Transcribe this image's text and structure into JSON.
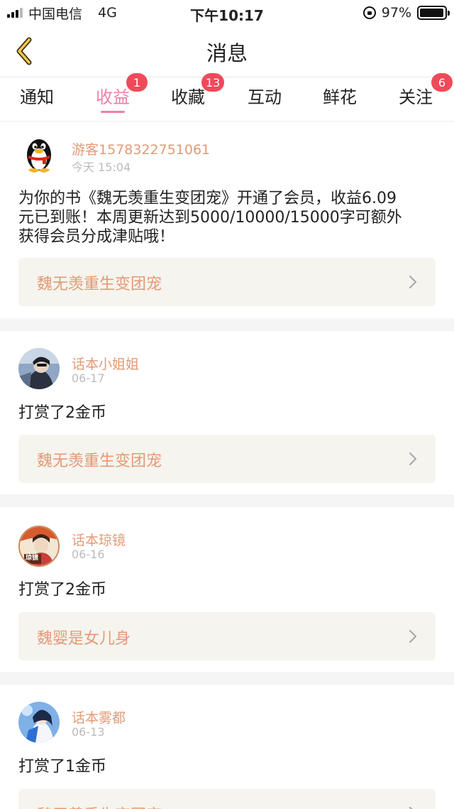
{
  "status_bar": {
    "carrier": "中国电信",
    "network": "4G",
    "time": "下午10:17",
    "battery": "97%",
    "battery_level": 0.97
  },
  "nav": {
    "title": "消息",
    "back_icon": "chevron-left-icon",
    "accent_color": "#f2c94c"
  },
  "tabs": [
    {
      "label": "通知",
      "badge": "",
      "active": false
    },
    {
      "label": "收益",
      "badge": "1",
      "active": true
    },
    {
      "label": "收藏",
      "badge": "13",
      "active": false
    },
    {
      "label": "互动",
      "badge": "",
      "active": false
    },
    {
      "label": "鲜花",
      "badge": "",
      "active": false
    },
    {
      "label": "关注",
      "badge": "6",
      "active": false
    }
  ],
  "colors": {
    "active_tab": "#f07fa8",
    "badge": "#f04a5a",
    "username": "#e39a76"
  },
  "messages": [
    {
      "username": "游客1578322751061",
      "time": "今天 15:04",
      "avatar_icon": "qq-penguin-icon",
      "text_lines": [
        "为你的书《魏无羡重生变团宠》开通了会员，收益6.09",
        "元已到账！本周更新达到5000/10000/15000字可额外",
        "获得会员分成津贴哦！"
      ],
      "book": "魏无羡重生变团宠"
    },
    {
      "username": "话本小姐姐",
      "time": "06-17",
      "avatar_icon": "user-avatar-icon",
      "text": "打赏了2金币",
      "book": "魏无羡重生变团宠"
    },
    {
      "username": "话本琼镜",
      "time": "06-16",
      "avatar_icon": "user-avatar-icon",
      "avatar_text": "琼镜",
      "text": "打赏了2金币",
      "book": "魏婴是女儿身"
    },
    {
      "username": "话本雾都",
      "time": "06-13",
      "avatar_icon": "user-avatar-icon",
      "text": "打赏了1金币",
      "book": "魏无羡重生变团宠"
    }
  ]
}
